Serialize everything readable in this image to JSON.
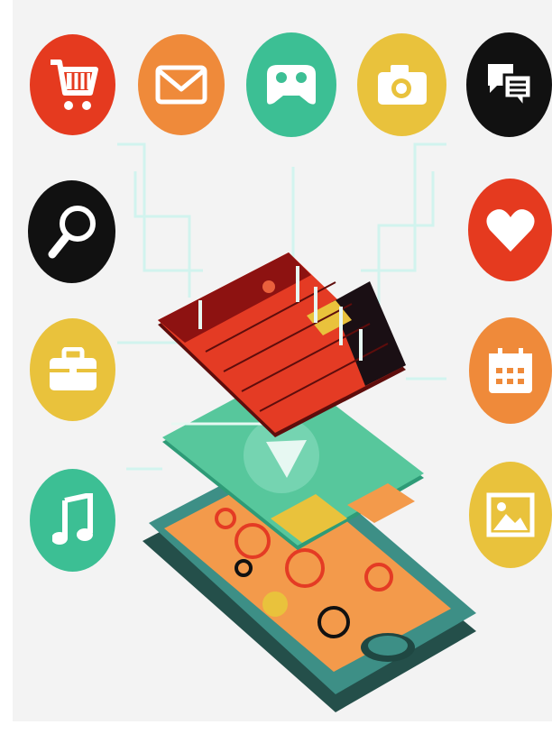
{
  "scene": "app-icons-around-smartphone",
  "colors": {
    "background": "#f3f3f3",
    "red": "#e53a1f",
    "orange": "#ef8a3a",
    "green": "#3cbf94",
    "yellow": "#e9c23c",
    "black": "#111111",
    "phone_body": "#3d8f86",
    "phone_screen": "#f39a4b",
    "layer_red": "#e43b24",
    "layer_dark": "#8d1211",
    "layer_green": "#57c79c",
    "layer_dark_green": "#2e9b77",
    "grid_line": "#bff3ec"
  },
  "icons": [
    {
      "name": "shopping-cart-icon",
      "color": "red"
    },
    {
      "name": "envelope-icon",
      "color": "orange"
    },
    {
      "name": "gamepad-icon",
      "color": "green"
    },
    {
      "name": "camera-icon",
      "color": "yellow"
    },
    {
      "name": "chat-bubbles-icon",
      "color": "black"
    },
    {
      "name": "magnifier-icon",
      "color": "black"
    },
    {
      "name": "heart-icon",
      "color": "red"
    },
    {
      "name": "briefcase-icon",
      "color": "yellow"
    },
    {
      "name": "calendar-icon",
      "color": "orange"
    },
    {
      "name": "music-note-icon",
      "color": "green"
    },
    {
      "name": "picture-icon",
      "color": "yellow"
    }
  ]
}
